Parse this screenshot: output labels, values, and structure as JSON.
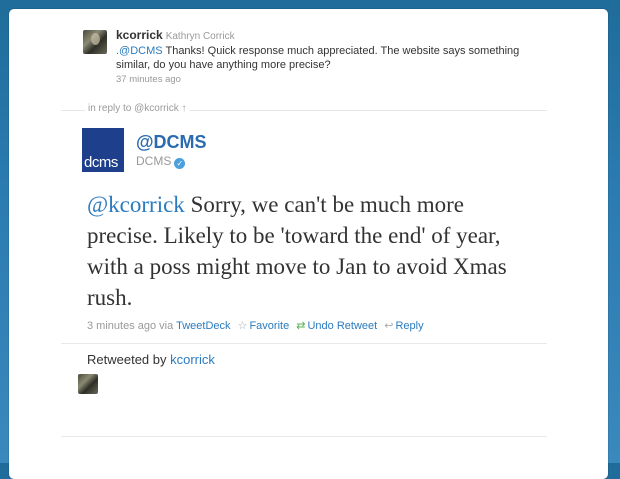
{
  "reply": {
    "screen_name": "kcorrick",
    "real_name": "Kathryn Corrick",
    "mention": ".@DCMS",
    "text": " Thanks! Quick response much appreciated. The website says something similar, do you have anything more precise?",
    "time": "37 minutes ago"
  },
  "in_reply_to": "in reply to @kcorrick ↑",
  "tweet": {
    "handle": "@DCMS",
    "name": "DCMS",
    "logo_text": "dcms",
    "mention": "@kcorrick",
    "text": " Sorry, we can't be much more precise. Likely to be 'toward the end' of year, with a poss might move to Jan to avoid Xmas rush.",
    "time": "3 minutes ago",
    "via_label": "via",
    "via": "TweetDeck",
    "favorite_label": "Favorite",
    "undo_retweet_label": "Undo Retweet",
    "reply_label": "Reply"
  },
  "retweeted_by": {
    "label": "Retweeted by",
    "user": "kcorrick"
  },
  "colors": {
    "background": "#2a7bb0",
    "link": "#2a7bbf",
    "dcms_logo": "#1d3f8c",
    "retweet_green": "#5bb255"
  }
}
